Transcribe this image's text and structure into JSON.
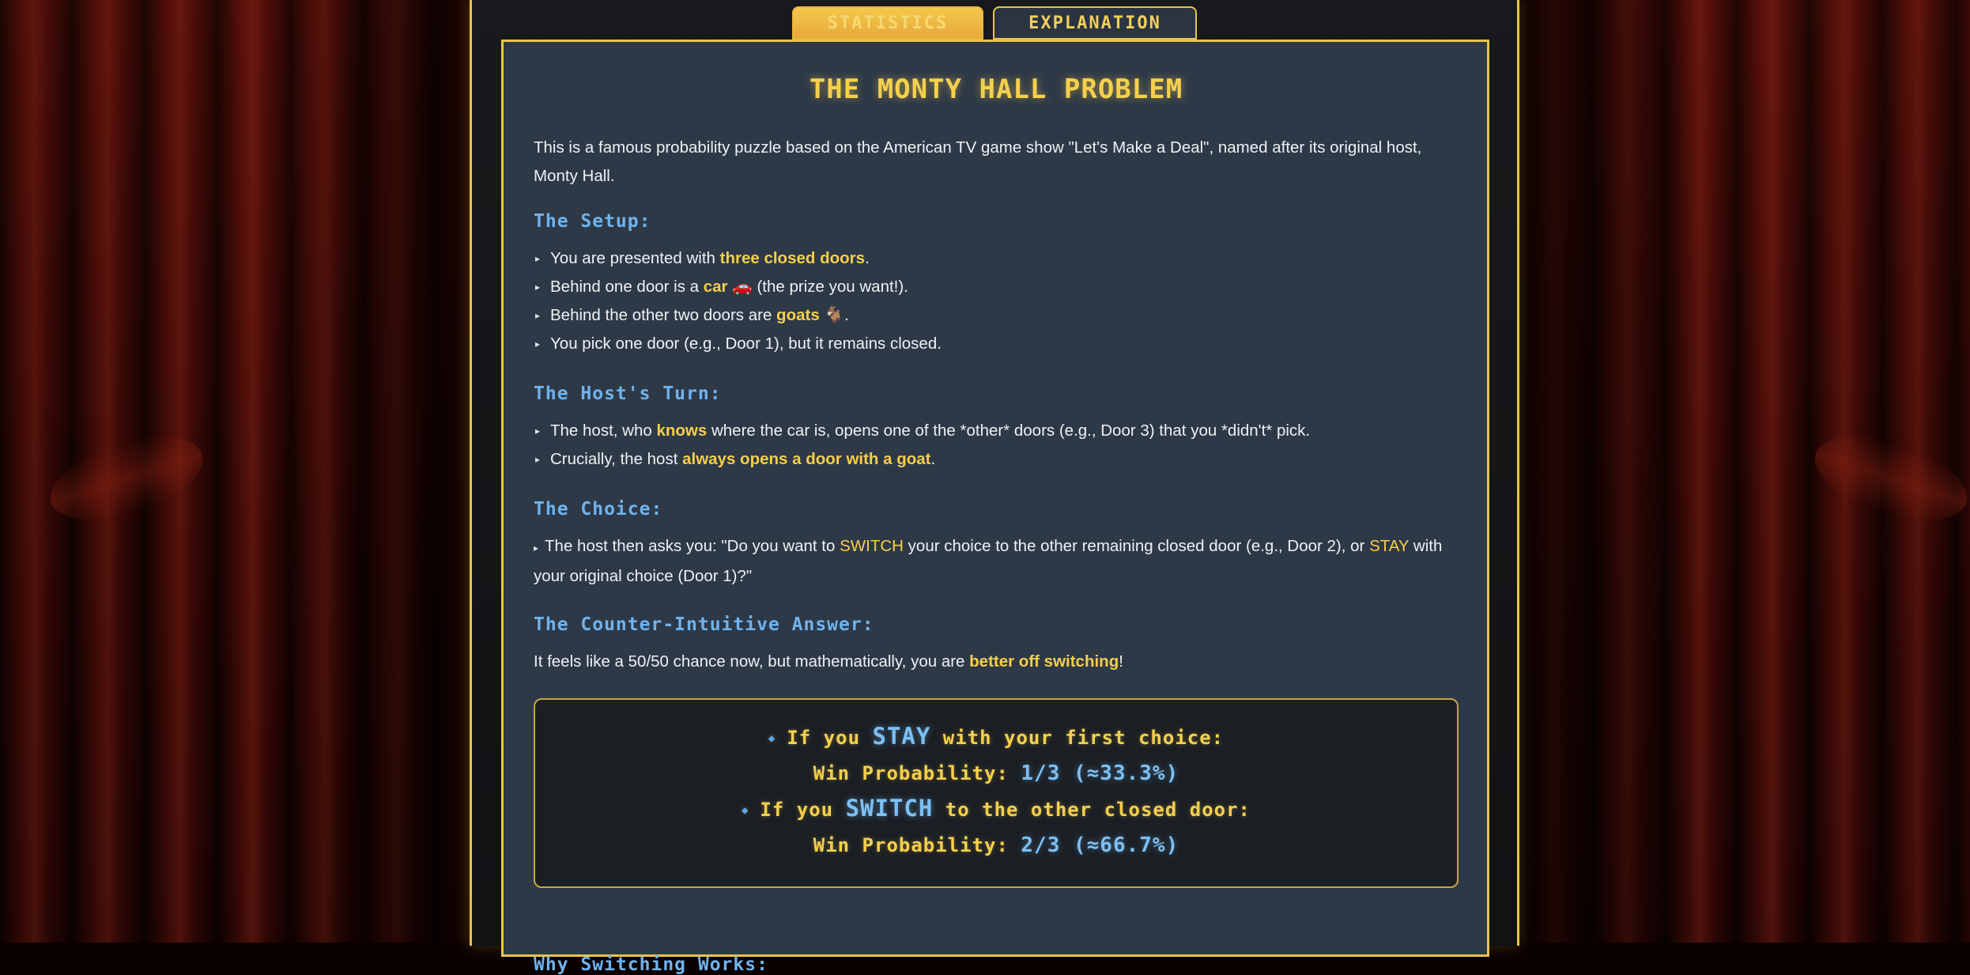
{
  "tabs": [
    {
      "label": "STATISTICS",
      "active": false
    },
    {
      "label": "EXPLANATION",
      "active": true
    }
  ],
  "title": "THE MONTY HALL PROBLEM",
  "intro": "This is a famous probability puzzle based on the American TV game show \"Let's Make a Deal\", named after its original host, Monty Hall.",
  "setup": {
    "heading": "The Setup:",
    "items": [
      {
        "a": "You are presented with ",
        "b": "three closed doors",
        "c": "."
      },
      {
        "a": "Behind one door is a ",
        "b": "car 🚗",
        "c": " (the prize you want!)."
      },
      {
        "a": "Behind the other two doors are ",
        "b": "goats 🐐",
        "c": "."
      },
      {
        "a": "You pick one door (e.g., Door 1), but it remains closed.",
        "b": "",
        "c": ""
      }
    ]
  },
  "host": {
    "heading": "The Host's Turn:",
    "items": [
      {
        "a": "The host, who ",
        "b": "knows",
        "c": " where the car is, opens one of the *other* doors (e.g., Door 3) that you *didn't* pick."
      },
      {
        "a": "Crucially, the host ",
        "b": "always opens a door with a goat",
        "c": "."
      }
    ]
  },
  "choice": {
    "heading": "The Choice:",
    "a": "The host then asks you: \"Do you want to ",
    "b": "SWITCH",
    "c": " your choice to the other remaining closed door (e.g., Door 2), or ",
    "d": "STAY",
    "e": " with your original choice (Door 1)?\""
  },
  "answer": {
    "heading": "The Counter-Intuitive Answer:",
    "a": "It feels like a 50/50 chance now, but mathematically, you are ",
    "b": "better off switching",
    "c": "!"
  },
  "box": {
    "stay_pre": "If you ",
    "stay_word": "STAY",
    "stay_post": " with your first choice:",
    "stay_prob_label": "Win Probability: ",
    "stay_prob": "1/3 (≈33.3%)",
    "switch_pre": "If you ",
    "switch_word": "SWITCH",
    "switch_post": " to the other closed door:",
    "switch_prob_label": "Win Probability: ",
    "switch_prob": "2/3 (≈66.7%)"
  },
  "why_heading": "Why Switching Works:",
  "colors": {
    "gold": "#e8c547",
    "highlight": "#f6cf4a",
    "heading_blue": "#6fb3ef",
    "panel": "#2e3947"
  }
}
